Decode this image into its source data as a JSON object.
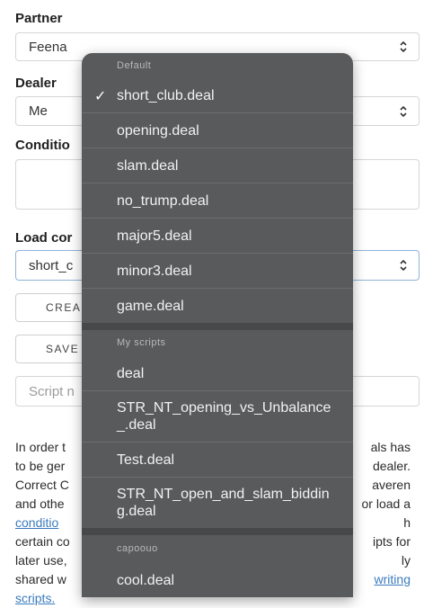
{
  "form": {
    "partner_label": "Partner",
    "partner_value": "Feena",
    "dealer_label": "Dealer",
    "dealer_value": "Me",
    "conditions_label": "Conditio",
    "load_label": "Load cor",
    "load_value": "short_c",
    "create_label": "CREA",
    "save_label": "SAVE",
    "script_placeholder": "Script n"
  },
  "paragraph": {
    "lines": [
      [
        "In order t",
        "als has"
      ],
      [
        "to be ger",
        "dealer."
      ],
      [
        "Correct C",
        "averen"
      ],
      [
        "and othe",
        "or load a"
      ],
      [
        "conditio",
        "h"
      ],
      [
        "certain co",
        "ipts for"
      ],
      [
        "later use,",
        "ly"
      ],
      [
        "shared w",
        "writing"
      ]
    ],
    "last": "scripts."
  },
  "menu": {
    "groups": [
      {
        "title": "Default",
        "items": [
          {
            "label": "short_club.deal",
            "selected": true
          },
          {
            "label": "opening.deal"
          },
          {
            "label": "slam.deal"
          },
          {
            "label": "no_trump.deal"
          },
          {
            "label": "major5.deal"
          },
          {
            "label": "minor3.deal"
          },
          {
            "label": "game.deal"
          }
        ]
      },
      {
        "title": "My scripts",
        "items": [
          {
            "label": "deal"
          },
          {
            "label": "STR_NT_opening_vs_Unbalance_.deal"
          },
          {
            "label": "Test.deal"
          },
          {
            "label": "STR_NT_open_and_slam_bidding.deal"
          }
        ]
      },
      {
        "title": "capoouo",
        "items": [
          {
            "label": "cool.deal"
          }
        ]
      }
    ],
    "check_icon": "✓"
  },
  "colors": {
    "menu_bg": "#595a5c",
    "link": "#3a7bbd"
  }
}
